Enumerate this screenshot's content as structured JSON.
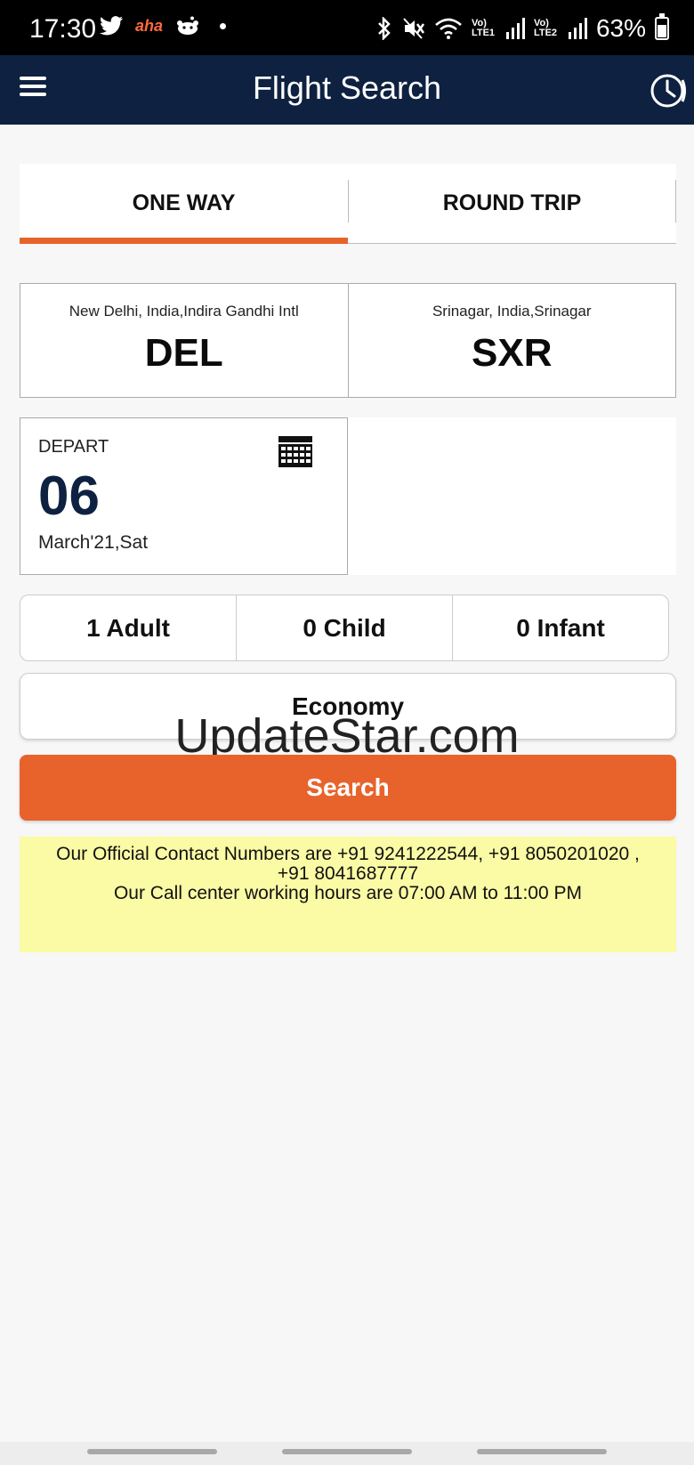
{
  "status_bar": {
    "time": "17:30",
    "left_icons": [
      "twitter-icon",
      "aha-icon",
      "reddit-icon",
      "dot-icon"
    ],
    "aha_label": "aha",
    "sim1_label": "Vo) LTE1",
    "sim2_label": "Vo) LTE2",
    "battery": "63%",
    "battery_level": 0.63
  },
  "app_bar": {
    "title": "Flight Search",
    "menu_icon": "hamburger-menu-icon",
    "history_icon": "clock-history-icon"
  },
  "tabs": [
    {
      "label": "ONE WAY",
      "active": true
    },
    {
      "label": "ROUND TRIP",
      "active": false
    }
  ],
  "origin": {
    "name": "New Delhi, India,Indira Gandhi Intl",
    "code": "DEL"
  },
  "destination": {
    "name": "Srinagar, India,Srinagar",
    "code": "SXR"
  },
  "depart": {
    "label": "DEPART",
    "day": "06",
    "month": "March'21,Sat",
    "icon": "calendar-icon"
  },
  "passengers": {
    "adult": "1 Adult",
    "child": "0 Child",
    "infant": "0 Infant"
  },
  "cabin_class": "Economy",
  "watermark": "UpdateStar.com",
  "search_label": "Search",
  "notice": {
    "line1": "Our Official Contact Numbers are +91 9241222544, +91 8050201020 ,",
    "line2": "+91 8041687777",
    "line3": "Our Call center working hours are 07:00 AM to 11:00 PM"
  },
  "colors": {
    "app_bar": "#0e2140",
    "accent": "#e8632c",
    "notice_bg": "#fbfaa5"
  }
}
